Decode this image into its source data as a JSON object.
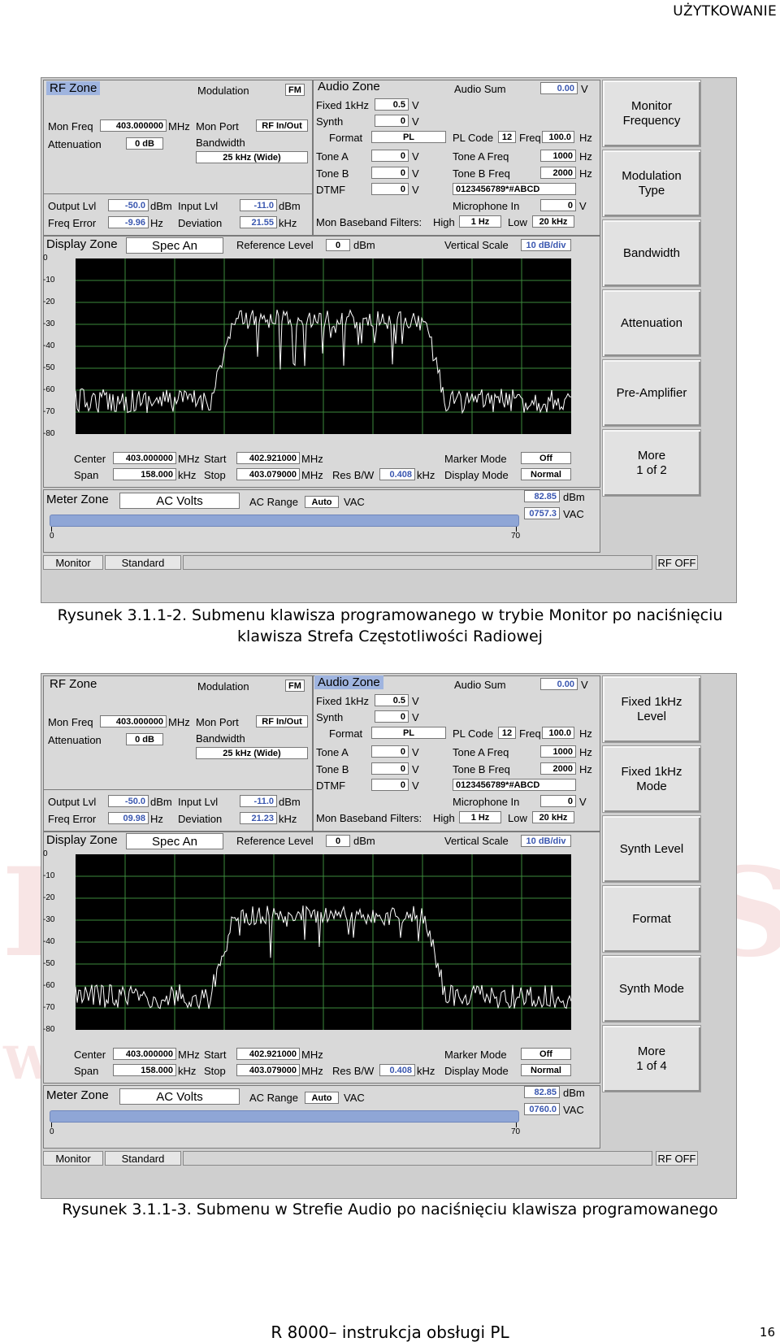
{
  "page_header": "UŻYTKOWANIE",
  "watermark": {
    "left": "D",
    "right": "S",
    "small": "W"
  },
  "figures": [
    {
      "caption_line1": "Rysunek 3.1.1-2. Submenu klawisza programowanego w trybie Monitor po naciśnięciu",
      "caption_line2": "klawisza Strefa Częstotliwości Radiowej",
      "rf_title": "RF Zone",
      "modulation_label": "Modulation",
      "modulation_value": "FM",
      "mon_freq_label": "Mon Freq",
      "mon_freq_value": "403.000000",
      "mon_freq_unit": "MHz",
      "mon_port_label": "Mon Port",
      "mon_port_value": "RF In/Out",
      "attenuation_label": "Attenuation",
      "attenuation_value": "0 dB",
      "bandwidth_label": "Bandwidth",
      "bandwidth_value": "25 kHz (Wide)",
      "output_lvl_label": "Output Lvl",
      "output_lvl_value": "-50.0",
      "output_lvl_unit": "dBm",
      "input_lvl_label": "Input Lvl",
      "input_lvl_value": "-11.0",
      "input_lvl_unit": "dBm",
      "freq_error_label": "Freq Error",
      "freq_error_value": "-9.96",
      "freq_error_unit": "Hz",
      "deviation_label": "Deviation",
      "deviation_value": "21.55",
      "deviation_unit": "kHz",
      "audio_title": "Audio Zone",
      "audio_sum_label": "Audio Sum",
      "audio_sum_value": "0.00",
      "audio_sum_unit": "V",
      "fixed_label": "Fixed 1kHz",
      "fixed_value": "0.5",
      "fixed_unit": "V",
      "synth_label": "Synth",
      "synth_value": "0",
      "synth_unit": "V",
      "format_label": "Format",
      "format_value": "PL",
      "pl_code_label": "PL Code",
      "pl_code_value": "12",
      "pl_freq_label": "Freq",
      "pl_freq_value": "100.0",
      "pl_freq_unit": "Hz",
      "tone_a_label": "Tone A",
      "tone_a_value": "0",
      "tone_a_unit": "V",
      "tone_a_freq_label": "Tone A Freq",
      "tone_a_freq_value": "1000",
      "tone_a_freq_unit": "Hz",
      "tone_b_label": "Tone B",
      "tone_b_value": "0",
      "tone_b_unit": "V",
      "tone_b_freq_label": "Tone B Freq",
      "tone_b_freq_value": "2000",
      "tone_b_freq_unit": "Hz",
      "dtmf_label": "DTMF",
      "dtmf_value": "0",
      "dtmf_unit": "V",
      "dtmf_string": "0123456789*#ABCD",
      "mic_label": "Microphone In",
      "mic_value": "0",
      "mic_unit": "V",
      "baseband_label": "Mon Baseband Filters:",
      "high_label": "High",
      "high_value": "1 Hz",
      "low_label": "Low",
      "low_value": "20 kHz",
      "display_title": "Display Zone",
      "display_mode_value": "Spec An",
      "ref_level_label": "Reference Level",
      "ref_level_value": "0",
      "ref_level_unit": "dBm",
      "vscale_label": "Vertical Scale",
      "vscale_value": "10 dB/div",
      "yticks": [
        "0",
        "-10",
        "-20",
        "-30",
        "-40",
        "-50",
        "-60",
        "-70",
        "-80"
      ],
      "center_label": "Center",
      "center_value": "403.000000",
      "center_unit": "MHz",
      "start_label": "Start",
      "start_value": "402.921000",
      "start_unit": "MHz",
      "span_label": "Span",
      "span_value": "158.000",
      "span_unit": "kHz",
      "stop_label": "Stop",
      "stop_value": "403.079000",
      "stop_unit": "MHz",
      "resbw_label": "Res B/W",
      "resbw_value": "0.408",
      "resbw_unit": "kHz",
      "marker_label": "Marker Mode",
      "marker_value": "Off",
      "dispmode_label": "Display Mode",
      "dispmode_value": "Normal",
      "meter_title": "Meter Zone",
      "meter_mode_value": "AC Volts",
      "ac_range_label": "AC Range",
      "ac_range_value": "Auto",
      "ac_range_unit": "VAC",
      "meter_dbm_value": "82.85",
      "meter_dbm_unit": "dBm",
      "meter_vac_value": "0757.3",
      "meter_vac_unit": "VAC",
      "scale_min": "0",
      "scale_max": "70",
      "tab_monitor": "Monitor",
      "tab_standard": "Standard",
      "tab_rfoff": "RF OFF",
      "softkeys": [
        "Monitor\nFrequency",
        "Modulation\nType",
        "Bandwidth",
        "Attenuation",
        "Pre-Amplifier",
        "More\n1 of 2"
      ]
    },
    {
      "caption_line1": "Rysunek 3.1.1-3. Submenu w Strefie Audio po naciśnięciu klawisza programowanego",
      "caption_line2": "",
      "rf_title": "RF Zone",
      "modulation_label": "Modulation",
      "modulation_value": "FM",
      "mon_freq_label": "Mon Freq",
      "mon_freq_value": "403.000000",
      "mon_freq_unit": "MHz",
      "mon_port_label": "Mon Port",
      "mon_port_value": "RF In/Out",
      "attenuation_label": "Attenuation",
      "attenuation_value": "0 dB",
      "bandwidth_label": "Bandwidth",
      "bandwidth_value": "25 kHz (Wide)",
      "output_lvl_label": "Output Lvl",
      "output_lvl_value": "-50.0",
      "output_lvl_unit": "dBm",
      "input_lvl_label": "Input Lvl",
      "input_lvl_value": "-11.0",
      "input_lvl_unit": "dBm",
      "freq_error_label": "Freq Error",
      "freq_error_value": "09.98",
      "freq_error_unit": "Hz",
      "deviation_label": "Deviation",
      "deviation_value": "21.23",
      "deviation_unit": "kHz",
      "audio_title": "Audio Zone",
      "audio_sum_label": "Audio Sum",
      "audio_sum_value": "0.00",
      "audio_sum_unit": "V",
      "fixed_label": "Fixed 1kHz",
      "fixed_value": "0.5",
      "fixed_unit": "V",
      "synth_label": "Synth",
      "synth_value": "0",
      "synth_unit": "V",
      "format_label": "Format",
      "format_value": "PL",
      "pl_code_label": "PL Code",
      "pl_code_value": "12",
      "pl_freq_label": "Freq",
      "pl_freq_value": "100.0",
      "pl_freq_unit": "Hz",
      "tone_a_label": "Tone A",
      "tone_a_value": "0",
      "tone_a_unit": "V",
      "tone_a_freq_label": "Tone A Freq",
      "tone_a_freq_value": "1000",
      "tone_a_freq_unit": "Hz",
      "tone_b_label": "Tone B",
      "tone_b_value": "0",
      "tone_b_unit": "V",
      "tone_b_freq_label": "Tone B Freq",
      "tone_b_freq_value": "2000",
      "tone_b_freq_unit": "Hz",
      "dtmf_label": "DTMF",
      "dtmf_value": "0",
      "dtmf_unit": "V",
      "dtmf_string": "0123456789*#ABCD",
      "mic_label": "Microphone In",
      "mic_value": "0",
      "mic_unit": "V",
      "baseband_label": "Mon Baseband Filters:",
      "high_label": "High",
      "high_value": "1 Hz",
      "low_label": "Low",
      "low_value": "20 kHz",
      "display_title": "Display Zone",
      "display_mode_value": "Spec An",
      "ref_level_label": "Reference Level",
      "ref_level_value": "0",
      "ref_level_unit": "dBm",
      "vscale_label": "Vertical Scale",
      "vscale_value": "10 dB/div",
      "yticks": [
        "0",
        "-10",
        "-20",
        "-30",
        "-40",
        "-50",
        "-60",
        "-70",
        "-80"
      ],
      "center_label": "Center",
      "center_value": "403.000000",
      "center_unit": "MHz",
      "start_label": "Start",
      "start_value": "402.921000",
      "start_unit": "MHz",
      "span_label": "Span",
      "span_value": "158.000",
      "span_unit": "kHz",
      "stop_label": "Stop",
      "stop_value": "403.079000",
      "stop_unit": "MHz",
      "resbw_label": "Res B/W",
      "resbw_value": "0.408",
      "resbw_unit": "kHz",
      "marker_label": "Marker Mode",
      "marker_value": "Off",
      "dispmode_label": "Display Mode",
      "dispmode_value": "Normal",
      "meter_title": "Meter Zone",
      "meter_mode_value": "AC Volts",
      "ac_range_label": "AC Range",
      "ac_range_value": "Auto",
      "ac_range_unit": "VAC",
      "meter_dbm_value": "82.85",
      "meter_dbm_unit": "dBm",
      "meter_vac_value": "0760.0",
      "meter_vac_unit": "VAC",
      "scale_min": "0",
      "scale_max": "70",
      "tab_monitor": "Monitor",
      "tab_standard": "Standard",
      "tab_rfoff": "RF OFF",
      "softkeys": [
        "Fixed 1kHz\nLevel",
        "Fixed 1kHz\nMode",
        "Synth Level",
        "Format",
        "Synth Mode",
        "More\n1 of 4"
      ]
    }
  ],
  "footer": "R 8000– instrukcja obsługi PL",
  "page_number": "16",
  "colors": {
    "selected_zone": "#9fb4df",
    "blue_value": "#3a57b0",
    "trace": "#ffffff",
    "grid": "#3c8a3c"
  }
}
